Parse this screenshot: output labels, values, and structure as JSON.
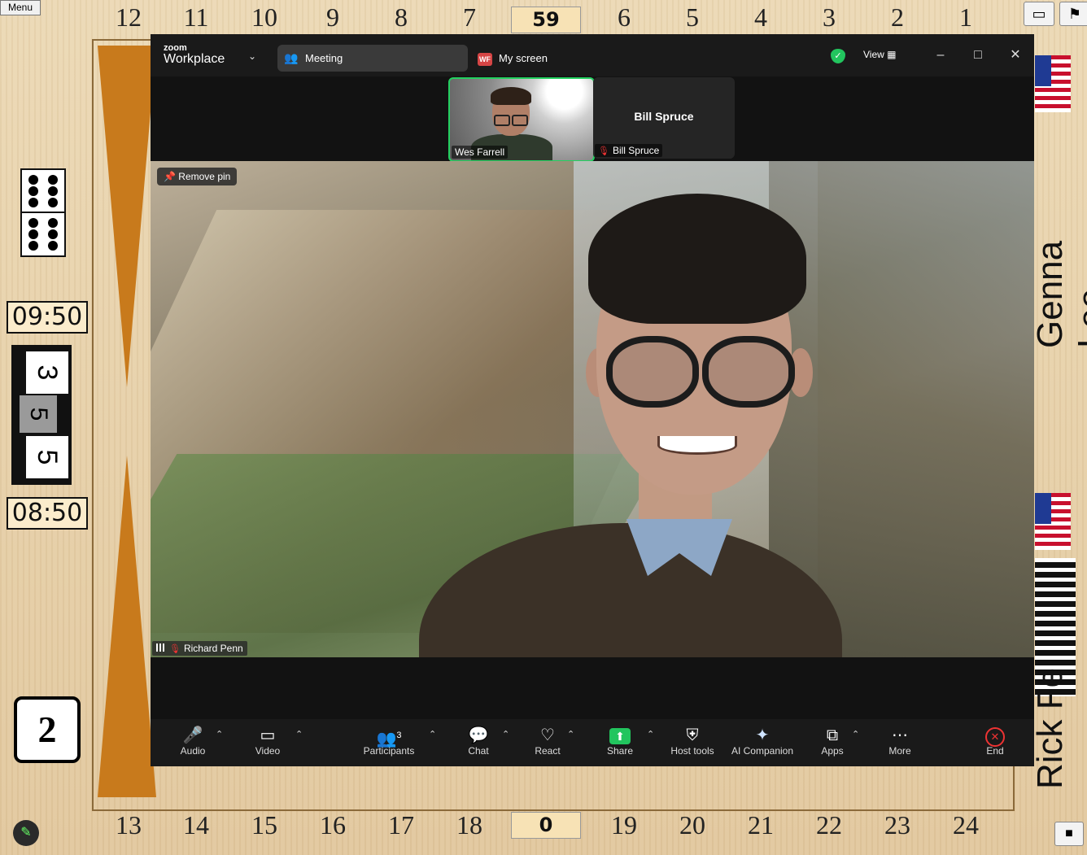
{
  "board": {
    "menu_label": "Menu",
    "top_points": [
      "12",
      "11",
      "10",
      "9",
      "8",
      "7",
      "6",
      "5",
      "4",
      "3",
      "2",
      "1"
    ],
    "bottom_points": [
      "13",
      "14",
      "15",
      "16",
      "17",
      "18",
      "19",
      "20",
      "21",
      "22",
      "23",
      "24"
    ],
    "top_score": "59",
    "bottom_score": "0",
    "clock_top": "09:50",
    "clock_bottom": "08:50",
    "dice": [
      "3",
      "5",
      "5"
    ],
    "cube_value": "2",
    "player_top": "Genna Lee",
    "player_bottom": "Rick Fe"
  },
  "zoom": {
    "logo_small": "zoom",
    "logo_big": "Workplace",
    "meeting_tab": "Meeting",
    "my_screen_initials": "WF",
    "my_screen_label": "My screen",
    "view_label": "View",
    "thumbnails": [
      {
        "name": "Wes Farrell"
      },
      {
        "name": "Bill Spruce",
        "center_name": "Bill Spruce"
      }
    ],
    "remove_pin_label": "Remove pin",
    "main_speaker": "Richard Penn",
    "toolbar": {
      "audio": "Audio",
      "video": "Video",
      "participants": "Participants",
      "participants_count": "3",
      "chat": "Chat",
      "react": "React",
      "share": "Share",
      "host_tools": "Host tools",
      "ai_companion": "AI Companion",
      "apps": "Apps",
      "more": "More",
      "end": "End"
    }
  }
}
